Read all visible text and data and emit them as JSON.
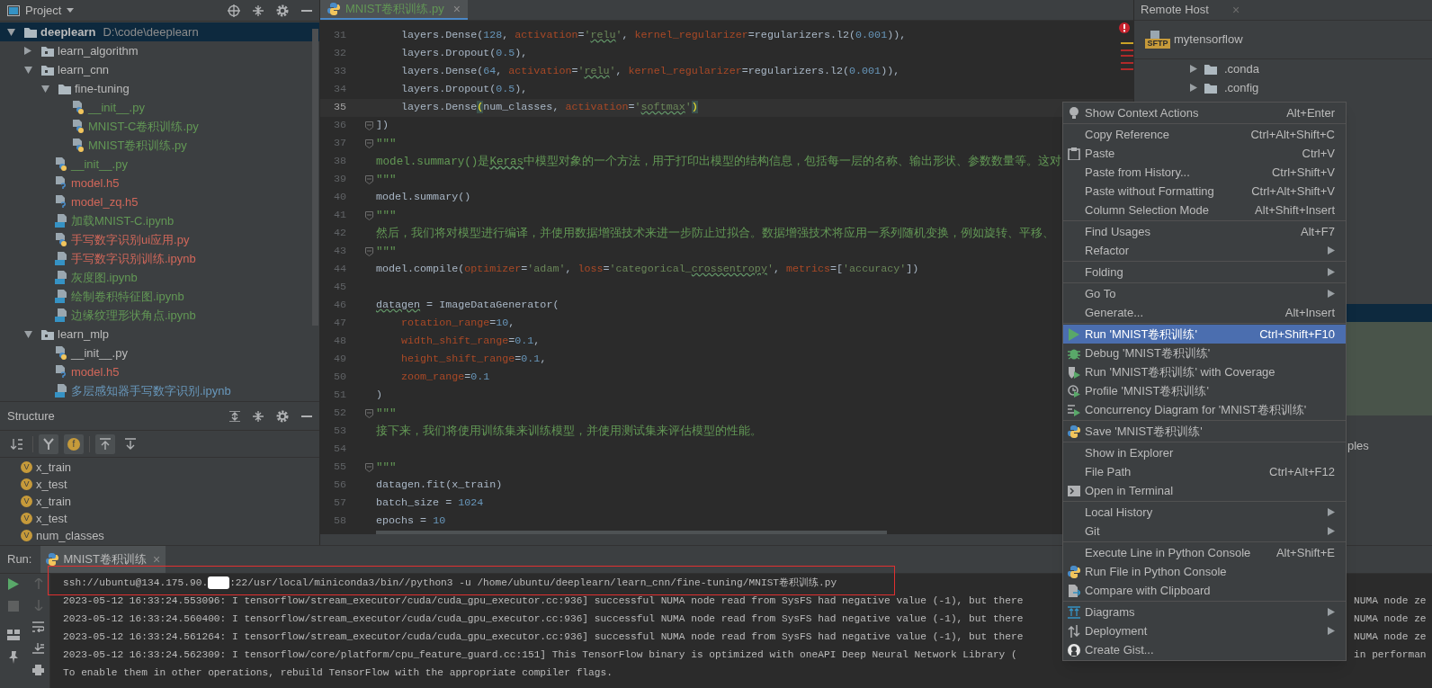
{
  "project": {
    "title": "Project",
    "tree": [
      {
        "name": "deeplearn",
        "path": "D:\\code\\deeplearn",
        "kind": "folder",
        "expanded": true,
        "selected": true,
        "children": [
          {
            "name": "learn_algorithm",
            "kind": "module",
            "expanded": false,
            "selected": false
          },
          {
            "name": "learn_cnn",
            "kind": "module",
            "expanded": true,
            "selected": false,
            "children": [
              {
                "name": "fine-tuning",
                "kind": "folder",
                "expanded": true,
                "selected": false,
                "children": [
                  {
                    "name": "__init__.py",
                    "kind": "python",
                    "color": "#629755",
                    "selected": false
                  },
                  {
                    "name": "MNIST-C卷积训练.py",
                    "kind": "python",
                    "color": "#629755",
                    "selected": false
                  },
                  {
                    "name": "MNIST卷积训练.py",
                    "kind": "python",
                    "color": "#629755",
                    "selected": false
                  }
                ]
              },
              {
                "name": "__init__.py",
                "kind": "python",
                "color": "#629755",
                "selected": false
              },
              {
                "name": "model.h5",
                "kind": "unknown",
                "color": "#d1675a",
                "selected": false
              },
              {
                "name": "model_zq.h5",
                "kind": "unknown",
                "color": "#d1675a",
                "selected": false
              },
              {
                "name": "加载MNIST-C.ipynb",
                "kind": "notebook",
                "color": "#629755",
                "selected": false
              },
              {
                "name": "手写数字识别ui应用.py",
                "kind": "python",
                "color": "#d1675a",
                "selected": false
              },
              {
                "name": "手写数字识别训练.ipynb",
                "kind": "notebook",
                "color": "#d1675a",
                "selected": false
              },
              {
                "name": "灰度图.ipynb",
                "kind": "notebook",
                "color": "#629755",
                "selected": false
              },
              {
                "name": "绘制卷积特征图.ipynb",
                "kind": "notebook",
                "color": "#629755",
                "selected": false
              },
              {
                "name": "边缘纹理形状角点.ipynb",
                "kind": "notebook",
                "color": "#629755",
                "selected": false
              }
            ]
          },
          {
            "name": "learn_mlp",
            "kind": "module",
            "expanded": true,
            "selected": false,
            "children": [
              {
                "name": "__init__.py",
                "kind": "python",
                "color": "#bbbbbb",
                "selected": false
              },
              {
                "name": "model.h5",
                "kind": "unknown",
                "color": "#d1675a",
                "selected": false
              },
              {
                "name": "多层感知器手写数字识别.ipynb",
                "kind": "notebook",
                "color": "#6897bb",
                "selected": false
              }
            ]
          }
        ]
      }
    ]
  },
  "structure": {
    "title": "Structure",
    "toolbar": [
      {
        "kind": "sort",
        "on": false
      },
      {
        "kind": "inherited",
        "on": true
      },
      {
        "kind": "fields",
        "glyph": "f",
        "on": true
      },
      {
        "kind": "scroll-to",
        "on": true
      },
      {
        "kind": "scroll-from",
        "on": false
      }
    ],
    "items": [
      {
        "badge": "V",
        "name": "x_train"
      },
      {
        "badge": "V",
        "name": "x_test"
      },
      {
        "badge": "V",
        "name": "x_train"
      },
      {
        "badge": "V",
        "name": "x_test"
      },
      {
        "badge": "V",
        "name": "num_classes"
      }
    ]
  },
  "editor": {
    "tab": {
      "label": "MNIST卷积训练.py",
      "close": "×",
      "selected": true
    },
    "lines": [
      {
        "number": "31",
        "current": false,
        "fold": false,
        "tokens": [
          {
            "text": "    layers.Dense(",
            "kind": "plain"
          },
          {
            "text": "128",
            "kind": "num"
          },
          {
            "text": ", ",
            "kind": "plain"
          },
          {
            "text": "activation",
            "kind": "param"
          },
          {
            "text": "=",
            "kind": "plain"
          },
          {
            "text": "'",
            "kind": "str"
          },
          {
            "text": "relu",
            "kind": "str_typo"
          },
          {
            "text": "'",
            "kind": "str"
          },
          {
            "text": ", ",
            "kind": "plain"
          },
          {
            "text": "kernel_regularizer",
            "kind": "param"
          },
          {
            "text": "=regularizers.l2(",
            "kind": "plain"
          },
          {
            "text": "0.001",
            "kind": "num"
          },
          {
            "text": ")),",
            "kind": "plain"
          }
        ]
      },
      {
        "number": "32",
        "current": false,
        "fold": false,
        "tokens": [
          {
            "text": "    layers.Dropout(",
            "kind": "plain"
          },
          {
            "text": "0.5",
            "kind": "num"
          },
          {
            "text": "),",
            "kind": "plain"
          }
        ]
      },
      {
        "number": "33",
        "current": false,
        "fold": false,
        "tokens": [
          {
            "text": "    layers.Dense(",
            "kind": "plain"
          },
          {
            "text": "64",
            "kind": "num"
          },
          {
            "text": ", ",
            "kind": "plain"
          },
          {
            "text": "activation",
            "kind": "param"
          },
          {
            "text": "=",
            "kind": "plain"
          },
          {
            "text": "'",
            "kind": "str"
          },
          {
            "text": "relu",
            "kind": "str_typo"
          },
          {
            "text": "'",
            "kind": "str"
          },
          {
            "text": ", ",
            "kind": "plain"
          },
          {
            "text": "kernel_regularizer",
            "kind": "param"
          },
          {
            "text": "=regularizers.l2(",
            "kind": "plain"
          },
          {
            "text": "0.001",
            "kind": "num"
          },
          {
            "text": ")),",
            "kind": "plain"
          }
        ]
      },
      {
        "number": "34",
        "current": false,
        "fold": false,
        "tokens": [
          {
            "text": "    layers.Dropout(",
            "kind": "plain"
          },
          {
            "text": "0.5",
            "kind": "num"
          },
          {
            "text": "),",
            "kind": "plain"
          }
        ]
      },
      {
        "number": "35",
        "current": true,
        "fold": false,
        "tokens": [
          {
            "text": "    layers.Dense",
            "kind": "plain"
          },
          {
            "text": "(",
            "kind": "paren_match"
          },
          {
            "text": "num_classes, ",
            "kind": "plain"
          },
          {
            "text": "activation",
            "kind": "param"
          },
          {
            "text": "=",
            "kind": "plain"
          },
          {
            "text": "'",
            "kind": "str"
          },
          {
            "text": "softmax",
            "kind": "str_typo"
          },
          {
            "text": "'",
            "kind": "str"
          },
          {
            "text": ")",
            "kind": "paren_match"
          }
        ]
      },
      {
        "number": "36",
        "current": false,
        "fold": true,
        "tokens": [
          {
            "text": "])",
            "kind": "plain"
          }
        ]
      },
      {
        "number": "37",
        "current": false,
        "fold": true,
        "tokens": [
          {
            "text": "\"\"\"",
            "kind": "doc"
          }
        ]
      },
      {
        "number": "38",
        "current": false,
        "fold": false,
        "tokens": [
          {
            "text": "model.summary()是",
            "kind": "doc"
          },
          {
            "text": "Keras",
            "kind": "doc_typo"
          },
          {
            "text": "中模型对象的一个方法，用于打印出模型的结构信息，包括每一层的名称、输出形状、参数数量等。这对",
            "kind": "doc"
          }
        ]
      },
      {
        "number": "39",
        "current": false,
        "fold": true,
        "tokens": [
          {
            "text": "\"\"\"",
            "kind": "doc"
          }
        ]
      },
      {
        "number": "40",
        "current": false,
        "fold": false,
        "tokens": [
          {
            "text": "model.summary()",
            "kind": "plain"
          }
        ]
      },
      {
        "number": "41",
        "current": false,
        "fold": true,
        "tokens": [
          {
            "text": "\"\"\"",
            "kind": "doc"
          }
        ]
      },
      {
        "number": "42",
        "current": false,
        "fold": false,
        "tokens": [
          {
            "text": "然后，我们将对模型进行编译，并使用数据增强技术来进一步防止过拟合。数据增强技术将应用一系列随机变换，例如旋转、平移、",
            "kind": "doc"
          }
        ]
      },
      {
        "number": "43",
        "current": false,
        "fold": true,
        "tokens": [
          {
            "text": "\"\"\"",
            "kind": "doc"
          }
        ]
      },
      {
        "number": "44",
        "current": false,
        "fold": false,
        "tokens": [
          {
            "text": "model.compile(",
            "kind": "plain"
          },
          {
            "text": "optimizer",
            "kind": "param"
          },
          {
            "text": "=",
            "kind": "plain"
          },
          {
            "text": "'adam'",
            "kind": "str"
          },
          {
            "text": ", ",
            "kind": "plain"
          },
          {
            "text": "loss",
            "kind": "param"
          },
          {
            "text": "=",
            "kind": "plain"
          },
          {
            "text": "'categorical_",
            "kind": "str"
          },
          {
            "text": "crossentropy",
            "kind": "str_typo"
          },
          {
            "text": "'",
            "kind": "str"
          },
          {
            "text": ", ",
            "kind": "plain"
          },
          {
            "text": "metrics",
            "kind": "param"
          },
          {
            "text": "=[",
            "kind": "plain"
          },
          {
            "text": "'accuracy'",
            "kind": "str"
          },
          {
            "text": "])",
            "kind": "plain"
          }
        ]
      },
      {
        "number": "45",
        "current": false,
        "fold": false
      },
      {
        "number": "46",
        "current": false,
        "fold": false,
        "tokens": [
          {
            "text": "datagen",
            "kind": "plain_typo"
          },
          {
            "text": " = ImageDataGenerator(",
            "kind": "plain"
          }
        ]
      },
      {
        "number": "47",
        "current": false,
        "fold": false,
        "tokens": [
          {
            "text": "    rotation_range",
            "kind": "param"
          },
          {
            "text": "=",
            "kind": "plain"
          },
          {
            "text": "10",
            "kind": "num"
          },
          {
            "text": ",",
            "kind": "plain"
          }
        ]
      },
      {
        "number": "48",
        "current": false,
        "fold": false,
        "tokens": [
          {
            "text": "    width_shift_range",
            "kind": "param"
          },
          {
            "text": "=",
            "kind": "plain"
          },
          {
            "text": "0.1",
            "kind": "num"
          },
          {
            "text": ",",
            "kind": "plain"
          }
        ]
      },
      {
        "number": "49",
        "current": false,
        "fold": false,
        "tokens": [
          {
            "text": "    height_shift_range",
            "kind": "param"
          },
          {
            "text": "=",
            "kind": "plain"
          },
          {
            "text": "0.1",
            "kind": "num"
          },
          {
            "text": ",",
            "kind": "plain"
          }
        ]
      },
      {
        "number": "50",
        "current": false,
        "fold": false,
        "tokens": [
          {
            "text": "    zoom_range",
            "kind": "param"
          },
          {
            "text": "=",
            "kind": "plain"
          },
          {
            "text": "0.1",
            "kind": "num"
          }
        ]
      },
      {
        "number": "51",
        "current": false,
        "fold": false,
        "tokens": [
          {
            "text": ")",
            "kind": "plain"
          }
        ]
      },
      {
        "number": "52",
        "current": false,
        "fold": true,
        "tokens": [
          {
            "text": "\"\"\"",
            "kind": "doc"
          }
        ]
      },
      {
        "number": "53",
        "current": false,
        "fold": false,
        "tokens": [
          {
            "text": "接下来，我们将使用训练集来训练模型，并使用测试集来评估模型的性能。",
            "kind": "doc"
          }
        ]
      },
      {
        "number": "54",
        "current": false,
        "fold": false
      },
      {
        "number": "55",
        "current": false,
        "fold": true,
        "tokens": [
          {
            "text": "\"\"\"",
            "kind": "doc"
          }
        ]
      },
      {
        "number": "56",
        "current": false,
        "fold": false,
        "tokens": [
          {
            "text": "datagen.fit(x_train)",
            "kind": "plain"
          }
        ]
      },
      {
        "number": "57",
        "current": false,
        "fold": false,
        "tokens": [
          {
            "text": "batch_size = ",
            "kind": "plain"
          },
          {
            "text": "1024",
            "kind": "num"
          }
        ]
      },
      {
        "number": "58",
        "current": false,
        "fold": false,
        "tokens": [
          {
            "text": "epochs = ",
            "kind": "plain"
          },
          {
            "text": "10",
            "kind": "num"
          }
        ]
      }
    ]
  },
  "remote_host": {
    "title": "Remote Host",
    "close": "×",
    "server": {
      "badge": "SFTP",
      "name": "mytensorflow"
    },
    "rows": [
      {
        "kind": "folder",
        "label": ".conda",
        "selected": false
      },
      {
        "kind": "folder",
        "label": ".config",
        "selected": false
      },
      {
        "kind": "band",
        "selected": true
      },
      {
        "kind": "band",
        "selected": false
      },
      {
        "kind": "fragment",
        "label": "ples",
        "selected": false
      }
    ]
  },
  "run": {
    "label": "Run:",
    "tab": {
      "label": "MNIST卷积训练",
      "close": "×",
      "selected": true
    },
    "lines": [
      {
        "kind": "command",
        "highlighted": true,
        "text": "ssh://ubuntu@134.175.90.",
        "text_after": ":22/usr/local/miniconda3/bin//python3 -u /home/ubuntu/deeplearn/learn_cnn/fine-tuning/MNIST卷积训练.py"
      },
      {
        "kind": "log",
        "highlighted": false,
        "text": "2023-05-12 16:33:24.553096: I tensorflow/stream_executor/cuda/cuda_gpu_executor.cc:936] successful NUMA node read from SysFS had negative value (-1), but there",
        "tail": "NUMA node ze"
      },
      {
        "kind": "log",
        "highlighted": false,
        "text": "2023-05-12 16:33:24.560400: I tensorflow/stream_executor/cuda/cuda_gpu_executor.cc:936] successful NUMA node read from SysFS had negative value (-1), but there",
        "tail": "NUMA node ze"
      },
      {
        "kind": "log",
        "highlighted": false,
        "text": "2023-05-12 16:33:24.561264: I tensorflow/stream_executor/cuda/cuda_gpu_executor.cc:936] successful NUMA node read from SysFS had negative value (-1), but there",
        "tail": "NUMA node ze"
      },
      {
        "kind": "log",
        "highlighted": false,
        "text": "2023-05-12 16:33:24.562309: I tensorflow/core/platform/cpu_feature_guard.cc:151] This TensorFlow binary is optimized with oneAPI Deep Neural Network Library (",
        "tail": "in performan"
      },
      {
        "kind": "log",
        "highlighted": false,
        "text": "To enable them in other operations, rebuild TensorFlow with the appropriate compiler flags."
      }
    ]
  },
  "context_menu": {
    "groups": [
      [
        {
          "label": "Show Context Actions",
          "shortcut": "Alt+Enter",
          "kind": "bulb",
          "submenu": false,
          "selected": false
        }
      ],
      [
        {
          "label": "Copy Reference",
          "shortcut": "Ctrl+Alt+Shift+C",
          "submenu": false,
          "selected": false
        },
        {
          "label": "Paste",
          "shortcut": "Ctrl+V",
          "kind": "clipboard",
          "submenu": false,
          "selected": false
        },
        {
          "label": "Paste from History...",
          "shortcut": "Ctrl+Shift+V",
          "submenu": false,
          "selected": false
        },
        {
          "label": "Paste without Formatting",
          "shortcut": "Ctrl+Alt+Shift+V",
          "submenu": false,
          "selected": false
        },
        {
          "label": "Column Selection Mode",
          "shortcut": "Alt+Shift+Insert",
          "submenu": false,
          "selected": false
        }
      ],
      [
        {
          "label": "Find Usages",
          "shortcut": "Alt+F7",
          "submenu": false,
          "selected": false
        },
        {
          "label": "Refactor",
          "submenu": true,
          "selected": false
        }
      ],
      [
        {
          "label": "Folding",
          "submenu": true,
          "selected": false
        }
      ],
      [
        {
          "label": "Go To",
          "submenu": true,
          "selected": false
        },
        {
          "label": "Generate...",
          "shortcut": "Alt+Insert",
          "submenu": false,
          "selected": false
        }
      ],
      [
        {
          "label": "Run 'MNIST卷积训练'",
          "shortcut": "Ctrl+Shift+F10",
          "kind": "run",
          "submenu": false,
          "selected": true
        },
        {
          "label": "Debug 'MNIST卷积训练'",
          "kind": "bug",
          "submenu": false,
          "selected": false
        },
        {
          "label": "Run 'MNIST卷积训练' with Coverage",
          "kind": "coverage",
          "submenu": false,
          "selected": false
        },
        {
          "label": "Profile 'MNIST卷积训练'",
          "kind": "profile",
          "submenu": false,
          "selected": false
        },
        {
          "label": "Concurrency Diagram for 'MNIST卷积训练'",
          "kind": "concurrency",
          "submenu": false,
          "selected": false
        }
      ],
      [
        {
          "label": "Save 'MNIST卷积训练'",
          "kind": "python",
          "submenu": false,
          "selected": false
        }
      ],
      [
        {
          "label": "Show in Explorer",
          "submenu": false,
          "selected": false
        },
        {
          "label": "File Path",
          "shortcut": "Ctrl+Alt+F12",
          "submenu": false,
          "selected": false
        },
        {
          "label": "Open in Terminal",
          "kind": "terminal",
          "submenu": false,
          "selected": false
        }
      ],
      [
        {
          "label": "Local History",
          "submenu": true,
          "selected": false
        },
        {
          "label": "Git",
          "submenu": true,
          "selected": false
        }
      ],
      [
        {
          "label": "Execute Line in Python Console",
          "shortcut": "Alt+Shift+E",
          "submenu": false,
          "selected": false
        },
        {
          "label": "Run File in Python Console",
          "kind": "python",
          "submenu": false,
          "selected": false
        },
        {
          "label": "Compare with Clipboard",
          "kind": "compare",
          "submenu": false,
          "selected": false
        }
      ],
      [
        {
          "label": "Diagrams",
          "kind": "diagram",
          "submenu": true,
          "selected": false
        },
        {
          "label": "Deployment",
          "kind": "deploy",
          "submenu": true,
          "selected": false
        },
        {
          "label": "Create Gist...",
          "kind": "gist",
          "submenu": false,
          "selected": false
        }
      ]
    ]
  }
}
